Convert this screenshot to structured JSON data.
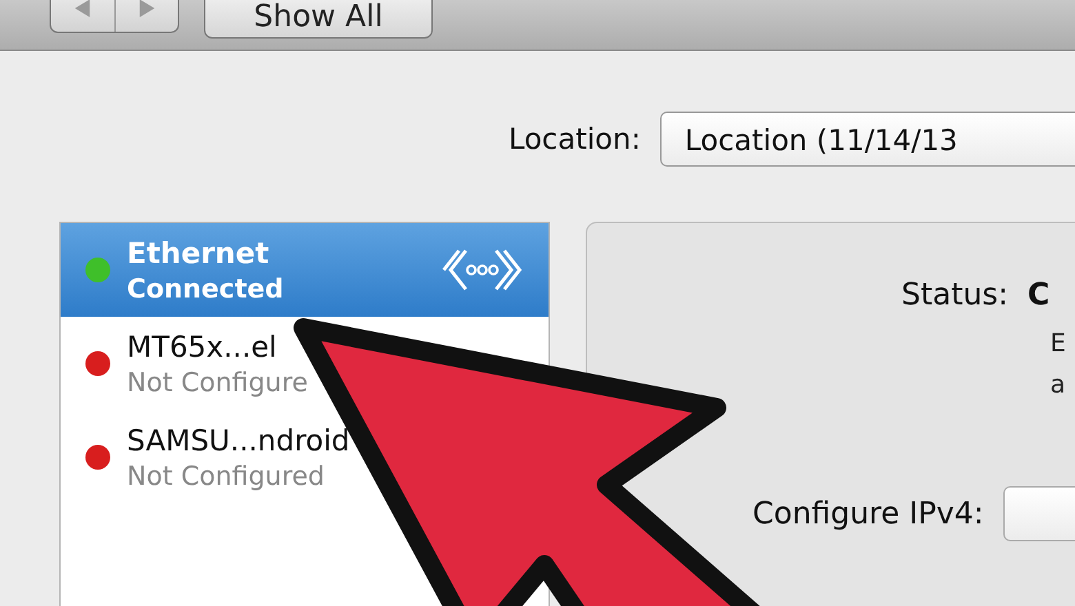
{
  "toolbar": {
    "show_all": "Show All"
  },
  "location": {
    "label": "Location:",
    "value": "Location (11/14/13"
  },
  "services": [
    {
      "name": "Ethernet",
      "status": "Connected",
      "selected": true,
      "color": "#3fbf2a"
    },
    {
      "name": "MT65x...el",
      "status": "Not Configure",
      "selected": false,
      "color": "#d81e1e"
    },
    {
      "name": "SAMSU...ndroid",
      "status": "Not Configured",
      "selected": false,
      "color": "#d81e1e"
    }
  ],
  "detail": {
    "status_label": "Status:",
    "status_value": "C",
    "description": [
      "E",
      "a"
    ],
    "configure_label": "Configure IPv4:"
  }
}
